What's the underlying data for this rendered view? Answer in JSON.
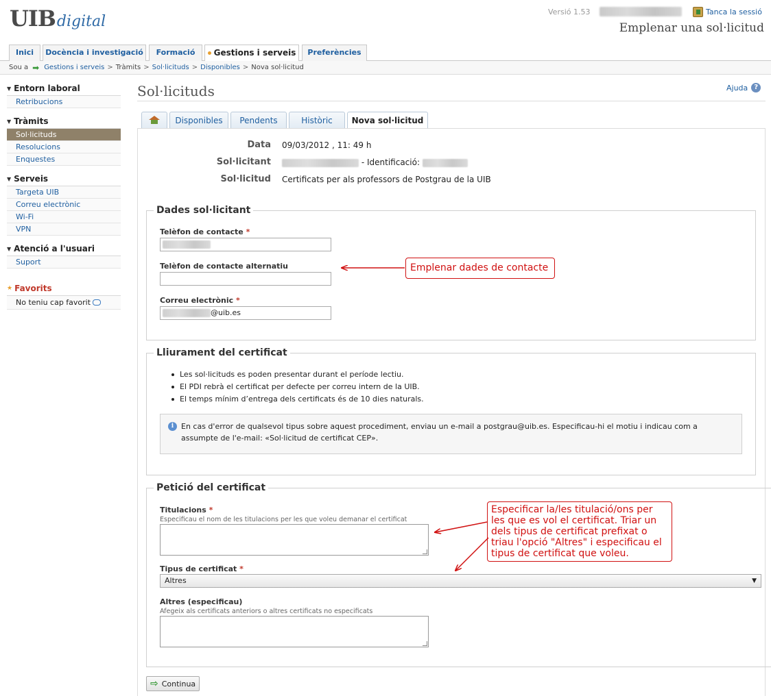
{
  "header": {
    "logo_main": "UIB",
    "logo_sub": "digital",
    "version": "Versió 1.53",
    "logout": "Tanca la sessió",
    "page_heading": "Emplenar una sol·licitud"
  },
  "main_tabs": [
    "Inici",
    "Docència i investigació",
    "Formació",
    "Gestions i serveis",
    "Preferències"
  ],
  "breadcrumb": {
    "prefix": "Sou a",
    "items": [
      "Gestions i serveis",
      "Tràmits",
      "Sol·licituds",
      "Disponibles",
      "Nova sol·licitud"
    ]
  },
  "sidebar": {
    "groups": [
      {
        "title": "Entorn laboral",
        "items": [
          "Retribucions"
        ]
      },
      {
        "title": "Tràmits",
        "items": [
          "Sol·licituds",
          "Resolucions",
          "Enquestes"
        ]
      },
      {
        "title": "Serveis",
        "items": [
          "Targeta UIB",
          "Correu electrònic",
          "Wi-Fi",
          "VPN"
        ]
      },
      {
        "title": "Atenció a l'usuari",
        "items": [
          "Suport"
        ]
      }
    ],
    "favorites_title": "Favorits",
    "favorites_empty": "No teniu cap favorit"
  },
  "content": {
    "title": "Sol·licituds",
    "help": "Ajuda",
    "tabs": [
      "Disponibles",
      "Pendents",
      "Històric",
      "Nova sol·licitud"
    ],
    "info": {
      "data_label": "Data",
      "data_value": "09/03/2012 , 11: 49 h",
      "solicitant_label": "Sol·licitant",
      "identificacio_label": "- Identificació:",
      "solicitud_label": "Sol·licitud",
      "solicitud_value": "Certificats per als professors de Postgrau de la UIB"
    },
    "dades": {
      "legend": "Dades sol·licitant",
      "tel_label": "Telèfon de contacte",
      "tel_alt_label": "Telèfon de contacte alternatiu",
      "email_label": "Correu electrònic",
      "email_suffix": "@uib.es",
      "required_mark": "*"
    },
    "lliurament": {
      "legend": "Lliurament del certificat",
      "bullets": [
        "Les sol·licituds es poden presentar durant el període lectiu.",
        "El PDI rebrà el certificat per defecte per correu intern de la UIB.",
        "El temps mínim d’entrega dels certificats és de 10 dies naturals."
      ],
      "notice": "En cas d'error de qualsevol tipus sobre aquest procediment, enviau un e-mail a postgrau@uib.es. Especificau-hi el motiu i indicau com a assumpte de l'e-mail: «Sol·licitud de certificat CEP»."
    },
    "peticio": {
      "legend": "Petició del certificat",
      "titulacions_label": "Titulacions",
      "titulacions_help": "Especificau el nom de les titulacions per les que voleu demanar el certificat",
      "tipus_label": "Tipus de certificat",
      "tipus_value": "Altres",
      "altres_label": "Altres (especificau)",
      "altres_help": "Afegeix als certificats anteriors o altres certificats no especificats"
    },
    "continue_button": "Continua"
  },
  "annotations": {
    "contact": "Emplenar dades de contacte",
    "titulacions": "Especificar la/les titulació/ons per les que es vol el certificat. Triar un dels tipus de certificat prefixat o triau l'opció \"Altres\" i especificau el tipus de certificat que voleu.",
    "color": "#d01010"
  }
}
